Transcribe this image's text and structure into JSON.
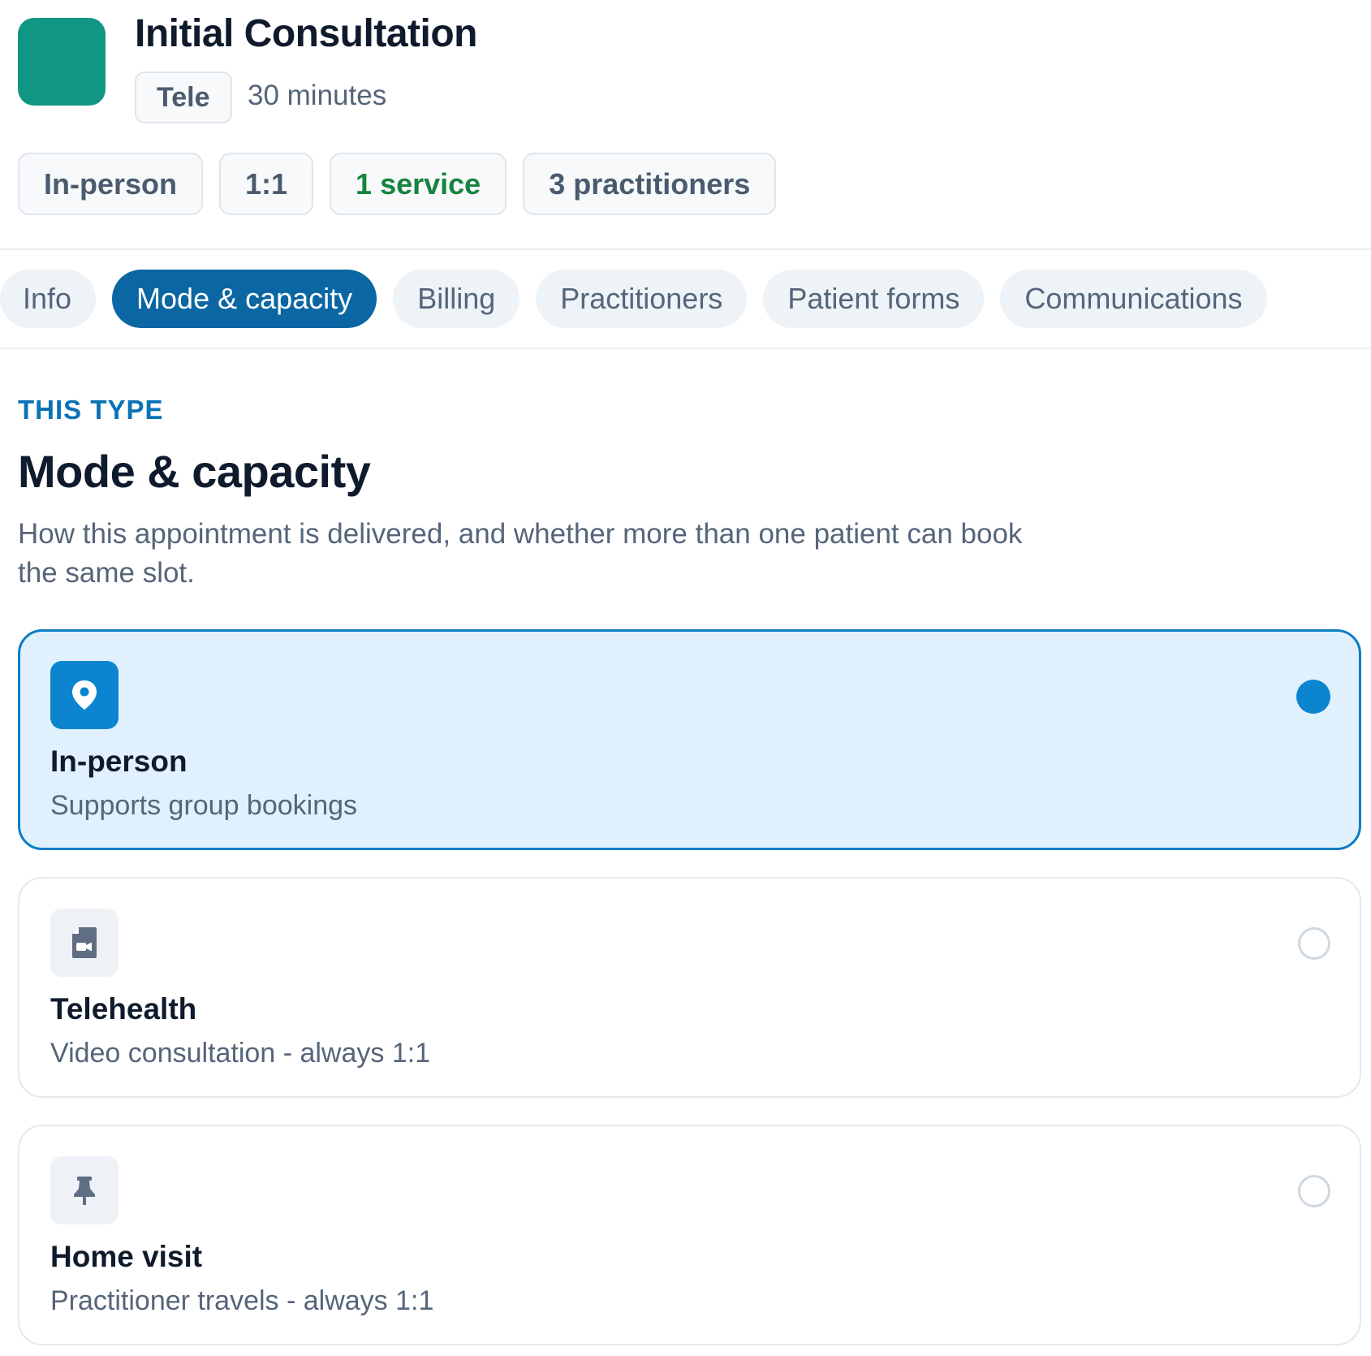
{
  "header": {
    "title": "Initial Consultation",
    "tag": "Tele",
    "duration": "30 minutes",
    "swatch_color": "#129684",
    "chips": [
      {
        "label": "In-person"
      },
      {
        "label": "1:1"
      },
      {
        "label": "1 service"
      },
      {
        "label": "3 practitioners"
      }
    ]
  },
  "tabs": [
    {
      "label": "Info"
    },
    {
      "label": "Mode & capacity",
      "active": true
    },
    {
      "label": "Billing"
    },
    {
      "label": "Practitioners"
    },
    {
      "label": "Patient forms"
    },
    {
      "label": "Communications"
    }
  ],
  "section": {
    "eyebrow": "THIS TYPE",
    "title": "Mode & capacity",
    "description": "How this appointment is delivered, and whether more than one patient can book the same slot."
  },
  "options": [
    {
      "label": "In-person",
      "description": "Supports group bookings",
      "icon": "map-pin-icon",
      "selected": true
    },
    {
      "label": "Telehealth",
      "description": "Video consultation - always 1:1",
      "icon": "video-file-icon",
      "selected": false
    },
    {
      "label": "Home visit",
      "description": "Practitioner travels - always 1:1",
      "icon": "pushpin-icon",
      "selected": false
    }
  ],
  "colors": {
    "accent": "#0b67a3",
    "selected_fill": "#e0f0fc",
    "radio_selected": "#0b85cf",
    "chip_green": "#16833f"
  }
}
